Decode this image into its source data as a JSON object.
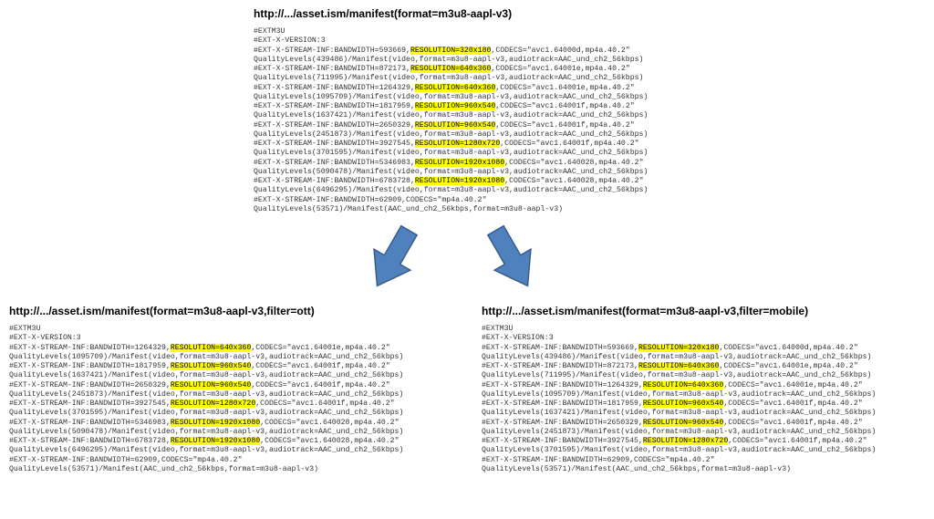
{
  "colors": {
    "highlight": "#ffff00",
    "arrow_fill": "#4F81BD",
    "arrow_stroke": "#385D8A"
  },
  "top": {
    "url": "http://.../asset.ism/manifest(format=m3u8-aapl-v3)",
    "header": [
      "#EXTM3U",
      "#EXT-X-VERSION:3"
    ],
    "streams": [
      {
        "bw": 593669,
        "res": "320x180",
        "codecs": "avc1.64000d,mp4a.40.2",
        "ql_bw": 439486,
        "audiotrack": "AAC_und_ch2_56kbps"
      },
      {
        "bw": 872173,
        "res": "640x360",
        "codecs": "avc1.64001e,mp4a.40.2",
        "ql_bw": 711995,
        "audiotrack": "AAC_und_ch2_56kbps"
      },
      {
        "bw": 1264329,
        "res": "640x360",
        "codecs": "avc1.64001e,mp4a.40.2",
        "ql_bw": 1095709,
        "audiotrack": "AAC_und_ch2_56kbps"
      },
      {
        "bw": 1817959,
        "res": "960x540",
        "codecs": "avc1.64001f,mp4a.40.2",
        "ql_bw": 1637421,
        "audiotrack": "AAC_und_ch2_56kbps"
      },
      {
        "bw": 2650329,
        "res": "960x540",
        "codecs": "avc1.64001f,mp4a.40.2",
        "ql_bw": 2451873,
        "audiotrack": "AAC_und_ch2_56kbps"
      },
      {
        "bw": 3927545,
        "res": "1280x720",
        "codecs": "avc1.64001f,mp4a.40.2",
        "ql_bw": 3701595,
        "audiotrack": "AAC_und_ch2_56kbps"
      },
      {
        "bw": 5346983,
        "res": "1920x1080",
        "codecs": "avc1.640028,mp4a.40.2",
        "ql_bw": 5090478,
        "audiotrack": "AAC_und_ch2_56kbps"
      },
      {
        "bw": 6783728,
        "res": "1920x1080",
        "codecs": "avc1.640028,mp4a.40.2",
        "ql_bw": 6496295,
        "audiotrack": "AAC_und_ch2_56kbps"
      }
    ],
    "audio_only": {
      "bw": 62909,
      "codecs": "mp4a.40.2",
      "ql_bw": 53571,
      "track": "AAC_und_ch2_56kbps"
    }
  },
  "left": {
    "url": "http://.../asset.ism/manifest(format=m3u8-aapl-v3,filter=ott)",
    "header": [
      "#EXTM3U",
      "#EXT-X-VERSION:3"
    ],
    "streams": [
      {
        "bw": 1264329,
        "res": "640x360",
        "codecs": "avc1.64001e,mp4a.40.2",
        "ql_bw": 1095709,
        "audiotrack": "AAC_und_ch2_56kbps"
      },
      {
        "bw": 1817959,
        "res": "960x540",
        "codecs": "avc1.64001f,mp4a.40.2",
        "ql_bw": 1637421,
        "audiotrack": "AAC_und_ch2_56kbps"
      },
      {
        "bw": 2650329,
        "res": "960x540",
        "codecs": "avc1.64001f,mp4a.40.2",
        "ql_bw": 2451873,
        "audiotrack": "AAC_und_ch2_56kbps"
      },
      {
        "bw": 3927545,
        "res": "1280x720",
        "codecs": "avc1.64001f,mp4a.40.2",
        "ql_bw": 3701595,
        "audiotrack": "AAC_und_ch2_56kbps"
      },
      {
        "bw": 5346983,
        "res": "1920x1080",
        "codecs": "avc1.640028,mp4a.40.2",
        "ql_bw": 5090478,
        "audiotrack": "AAC_und_ch2_56kbps"
      },
      {
        "bw": 6783728,
        "res": "1920x1080",
        "codecs": "avc1.640028,mp4a.40.2",
        "ql_bw": 6496295,
        "audiotrack": "AAC_und_ch2_56kbps"
      }
    ],
    "audio_only": {
      "bw": 62909,
      "codecs": "mp4a.40.2",
      "ql_bw": 53571,
      "track": "AAC_und_ch2_56kbps"
    }
  },
  "right": {
    "url": "http://.../asset.ism/manifest(format=m3u8-aapl-v3,filter=mobile)",
    "header": [
      "#EXTM3U",
      "#EXT-X-VERSION:3"
    ],
    "streams": [
      {
        "bw": 593669,
        "res": "320x180",
        "codecs": "avc1.64000d,mp4a.40.2",
        "ql_bw": 439486,
        "audiotrack": "AAC_und_ch2_56kbps"
      },
      {
        "bw": 872173,
        "res": "640x360",
        "codecs": "avc1.64001e,mp4a.40.2",
        "ql_bw": 711995,
        "audiotrack": "AAC_und_ch2_56kbps"
      },
      {
        "bw": 1264329,
        "res": "640x360",
        "codecs": "avc1.64001e,mp4a.40.2",
        "ql_bw": 1095709,
        "audiotrack": "AAC_und_ch2_56kbps"
      },
      {
        "bw": 1817959,
        "res": "960x540",
        "codecs": "avc1.64001f,mp4a.40.2",
        "ql_bw": 1637421,
        "audiotrack": "AAC_und_ch2_56kbps"
      },
      {
        "bw": 2650329,
        "res": "960x540",
        "codecs": "avc1.64001f,mp4a.40.2",
        "ql_bw": 2451873,
        "audiotrack": "AAC_und_ch2_56kbps"
      },
      {
        "bw": 3927545,
        "res": "1280x720",
        "codecs": "avc1.64001f,mp4a.40.2",
        "ql_bw": 3701595,
        "audiotrack": "AAC_und_ch2_56kbps"
      }
    ],
    "audio_only": {
      "bw": 62909,
      "codecs": "mp4a.40.2",
      "ql_bw": 53571,
      "track": "AAC_und_ch2_56kbps"
    }
  }
}
